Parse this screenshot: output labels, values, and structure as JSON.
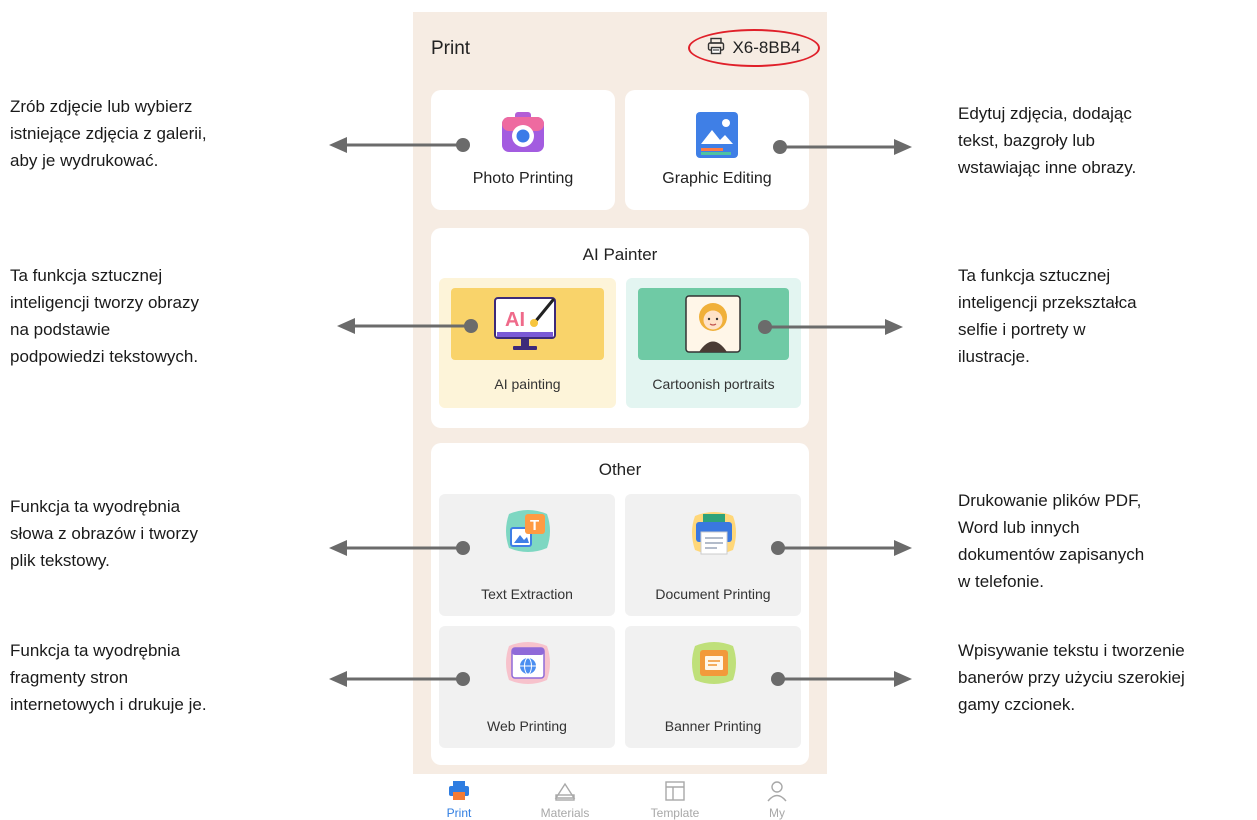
{
  "header": {
    "title": "Print",
    "device_name": "X6-8BB4"
  },
  "tiles": {
    "photo_printing": "Photo Printing",
    "graphic_editing": "Graphic Editing"
  },
  "ai_painter": {
    "title": "AI Painter",
    "ai_painting": "AI painting",
    "cartoonish_portraits": "Cartoonish portraits",
    "ai_badge": "AI"
  },
  "other": {
    "title": "Other",
    "text_extraction": "Text Extraction",
    "document_printing": "Document Printing",
    "web_printing": "Web Printing",
    "banner_printing": "Banner Printing",
    "text_badge": "T"
  },
  "nav": {
    "print": "Print",
    "materials": "Materials",
    "template": "Template",
    "my": "My"
  },
  "annotations": {
    "photo": [
      "Zrób zdjęcie lub wybierz",
      "istniejące zdjęcia z galerii,",
      "aby je wydrukować."
    ],
    "graphic": [
      "Edytuj zdjęcia, dodając",
      "tekst, bazgroły lub",
      "wstawiając inne obrazy."
    ],
    "ai_painting": [
      "Ta funkcja sztucznej",
      "inteligencji tworzy obrazy",
      "na podstawie",
      "podpowiedzi tekstowych."
    ],
    "cartoon": [
      "Ta funkcja sztucznej",
      "inteligencji przekształca",
      "selfie i portrety w",
      "ilustracje."
    ],
    "text_extraction": [
      "Funkcja ta wyodrębnia",
      "słowa z obrazów i tworzy",
      "plik tekstowy."
    ],
    "document": [
      "Drukowanie plików PDF,",
      "Word lub innych",
      "dokumentów zapisanych",
      "w telefonie."
    ],
    "web": [
      "Funkcja ta wyodrębnia",
      "fragmenty stron",
      "internetowych i drukuje je."
    ],
    "banner": [
      "Wpisywanie tekstu i tworzenie",
      "banerów przy użyciu szerokiej",
      "gamy czcionek."
    ]
  },
  "colors": {
    "phone_bg": "#f6ece3",
    "highlight_ring": "#e0202a",
    "nav_active": "#2f7de1",
    "nav_inactive": "#a8a8a8",
    "arrow": "#6b6b6b"
  },
  "icons": {
    "device": "printer-icon",
    "photo": "camera-icon",
    "graphic": "image-icon",
    "ai": "monitor-brush-icon",
    "cartoon": "portrait-icon",
    "text": "text-extract-icon",
    "document": "document-printer-icon",
    "web": "globe-icon",
    "banner": "banner-icon"
  }
}
